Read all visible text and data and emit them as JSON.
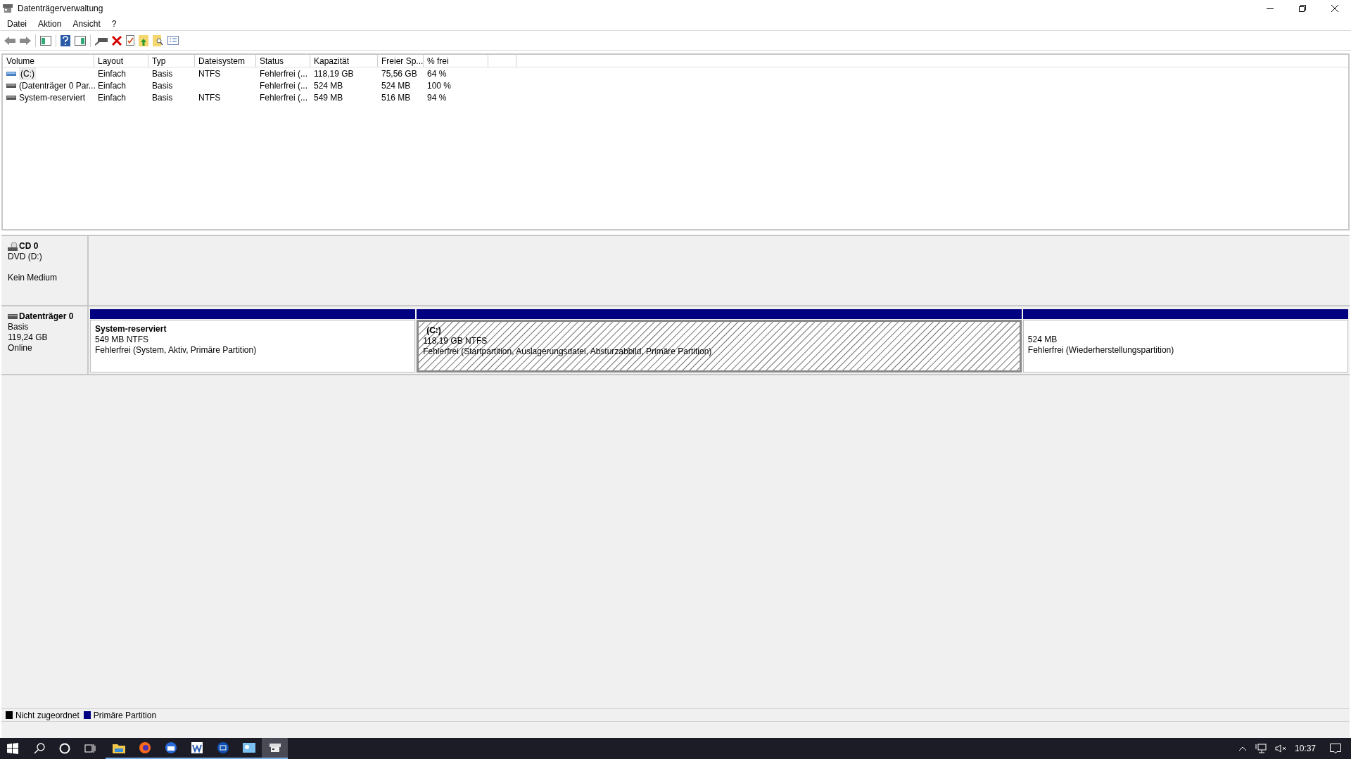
{
  "window": {
    "title": "Datenträgerverwaltung"
  },
  "menu": [
    "Datei",
    "Aktion",
    "Ansicht",
    "?"
  ],
  "table": {
    "columns": [
      "Volume",
      "Layout",
      "Typ",
      "Dateisystem",
      "Status",
      "Kapazität",
      "Freier Sp...",
      "% frei"
    ],
    "rows": [
      {
        "cells": [
          "(C:)",
          "Einfach",
          "Basis",
          "NTFS",
          "Fehlerfrei (...",
          "118,19 GB",
          "75,56 GB",
          "64 %"
        ],
        "selected": true
      },
      {
        "cells": [
          "(Datenträger 0 Par...",
          "Einfach",
          "Basis",
          "",
          "Fehlerfrei (...",
          "524 MB",
          "524 MB",
          "100 %"
        ],
        "selected": false
      },
      {
        "cells": [
          "System-reserviert",
          "Einfach",
          "Basis",
          "NTFS",
          "Fehlerfrei (...",
          "549 MB",
          "516 MB",
          "94 %"
        ],
        "selected": false
      }
    ]
  },
  "disks": [
    {
      "kind": "cd",
      "name": "CD 0",
      "lines": [
        "DVD (D:)"
      ],
      "status": "Kein Medium"
    },
    {
      "kind": "disk",
      "name": "Datenträger 0",
      "lines": [
        "Basis",
        "119,24 GB"
      ],
      "status": "Online",
      "partitions": [
        {
          "title": "System-reserviert",
          "size": "549 MB NTFS",
          "status": "Fehlerfrei (System, Aktiv, Primäre Partition)",
          "selected": false,
          "color": "#000080"
        },
        {
          "title": "(C:)",
          "size": "118,19 GB NTFS",
          "status": "Fehlerfrei (Startpartition, Auslagerungsdatei, Absturzabbild, Primäre Partition)",
          "selected": true,
          "color": "#000080"
        },
        {
          "size": "524 MB",
          "status": "Fehlerfrei (Wiederherstellungspartition)",
          "selected": false,
          "color": "#000080"
        }
      ]
    }
  ],
  "legend": [
    {
      "label": "Nicht zugeordnet",
      "color": "#000000"
    },
    {
      "label": "Primäre Partition",
      "color": "#000080"
    }
  ],
  "taskbar": {
    "clock": "10:37"
  }
}
